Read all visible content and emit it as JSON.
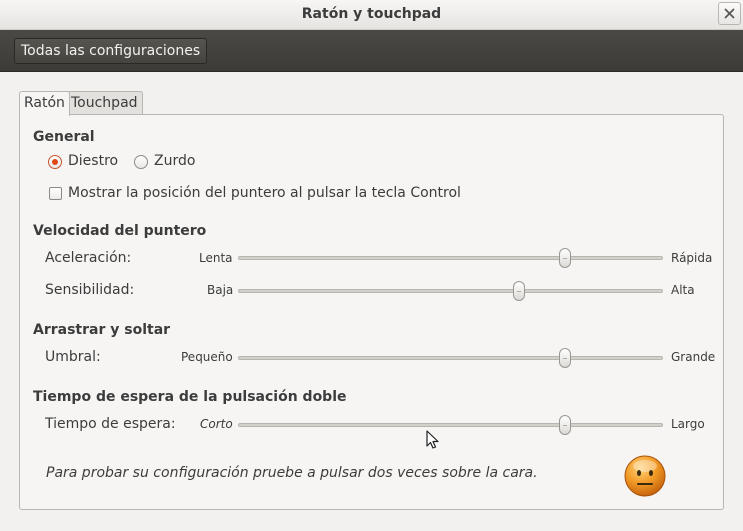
{
  "window": {
    "title": "Ratón y touchpad",
    "close_icon": "close-icon"
  },
  "toolbar": {
    "all_settings_label": "Todas las configuraciones"
  },
  "tabs": [
    {
      "label": "Ratón",
      "active": true
    },
    {
      "label": "Touchpad",
      "active": false
    }
  ],
  "general": {
    "title": "General",
    "handedness": {
      "options": [
        "Diestro",
        "Zurdo"
      ],
      "selected": "Diestro"
    },
    "show_pointer": {
      "label": "Mostrar la posición del puntero al pulsar la tecla Control",
      "checked": false
    }
  },
  "pointer_speed": {
    "title": "Velocidad del puntero",
    "acceleration": {
      "label": "Aceleración:",
      "min_label": "Lenta",
      "max_label": "Rápida",
      "value": 0.77
    },
    "sensitivity": {
      "label": "Sensibilidad:",
      "min_label": "Baja",
      "max_label": "Alta",
      "value": 0.66
    }
  },
  "drag_drop": {
    "title": "Arrastrar y soltar",
    "threshold": {
      "label": "Umbral:",
      "min_label": "Pequeño",
      "max_label": "Grande",
      "value": 0.77
    }
  },
  "double_click": {
    "title": "Tiempo de espera de la pulsación doble",
    "timeout": {
      "label": "Tiempo de espera:",
      "min_label": "Corto",
      "max_label": "Largo",
      "value": 0.77
    },
    "hint": "Para probar su configuración pruebe a pulsar dos veces sobre la cara.",
    "face_icon": "neutral-face-icon"
  },
  "colors": {
    "accent": "#dd4814",
    "toolbar_bg": "#3c3b37",
    "face": "#f29b27"
  }
}
